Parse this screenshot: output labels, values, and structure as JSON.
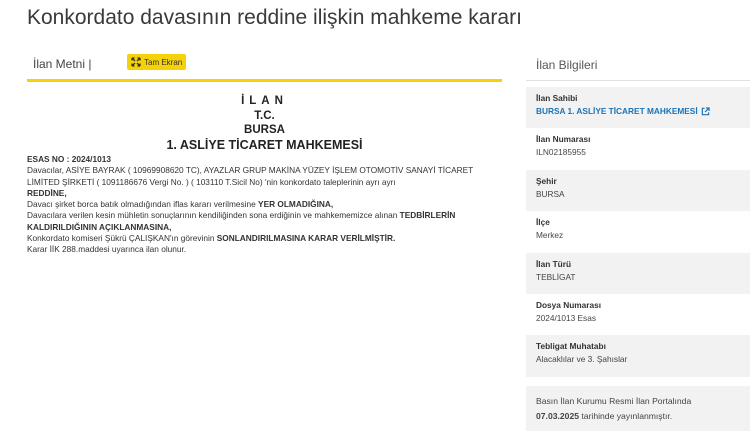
{
  "page": {
    "title": "Konkordato davasının reddine ilişkin mahkeme kararı"
  },
  "tabs": {
    "text_label": "İlan Metni |",
    "fullscreen_label": "Tam Ekran"
  },
  "notice": {
    "header_ilan": "İLAN",
    "header_tc": "T.C.",
    "header_city": "BURSA",
    "header_court": "1. ASLİYE TİCARET MAHKEMESİ",
    "esas": "ESAS NO : 2024/1013",
    "p1": "Davacılar, ASİYE BAYRAK ( 10969908620 TC), AYAZLAR GRUP MAKİNA YÜZEY İŞLEM OTOMOTİV SANAYİ TİCARET LİMİTED ŞİRKETİ ( 1091186676 Vergi No. ) ( 103110 T.Sicil No) 'nin konkordato taleplerinin ayrı ayrı",
    "p1_bold": "REDDİNE,",
    "p2_pre": "Davacı şirket borca batık olmadığından iflas kararı verilmesine ",
    "p2_bold": "YER OLMADIĞINA,",
    "p3_pre": "Davacılara verilen kesin mühletin sonuçlarının kendiliğinden sona erdiğinin ve mahkememizce alınan ",
    "p3_bold": "TEDBİRLERİN KALDIRILDIĞININ AÇIKLANMASINA,",
    "p4_pre": "Konkordato komiseri Şükrü ÇALIŞKAN'ın görevinin ",
    "p4_bold": "SONLANDIRILMASINA KARAR VERİLMİŞTİR.",
    "p5": "Karar İİK 288.maddesi uyarınca ilan olunur."
  },
  "info": {
    "title": "İlan Bilgileri",
    "rows": [
      {
        "label": "İlan Sahibi",
        "value": "BURSA 1. ASLİYE TİCARET MAHKEMESİ"
      },
      {
        "label": "İlan Numarası",
        "value": "ILN02185955"
      },
      {
        "label": "Şehir",
        "value": "BURSA"
      },
      {
        "label": "İlçe",
        "value": "Merkez"
      },
      {
        "label": "İlan Türü",
        "value": "TEBLİGAT"
      },
      {
        "label": "Dosya Numarası",
        "value": "2024/1013 Esas"
      },
      {
        "label": "Tebligat Muhatabı",
        "value": "Alacaklılar ve 3. Şahıslar"
      }
    ]
  },
  "footer": {
    "text_pre": "Basın İlan Kurumu Resmi İlan Portalında",
    "date": "07.03.2025",
    "text_post": " tarihinde yayınlanmıştır."
  },
  "colors": {
    "accent": "#f5d10a",
    "link": "#1a73b8",
    "panel_bg": "#f2f2f2"
  }
}
